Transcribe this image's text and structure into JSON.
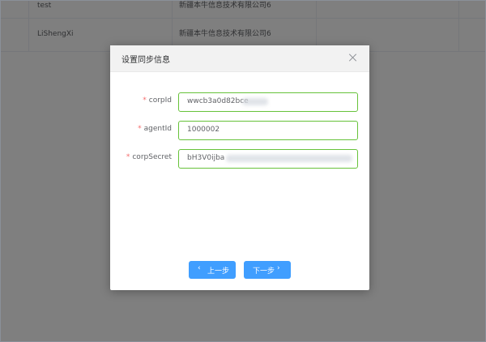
{
  "background_table": {
    "rows": [
      {
        "name": "test",
        "company": "新疆本牛信息技术有限公司6"
      },
      {
        "name": "LiShengXi",
        "company": "新疆本牛信息技术有限公司6"
      }
    ]
  },
  "dialog": {
    "title": "设置同步信息",
    "fields": [
      {
        "label": "corpId",
        "value": "wwcb3a0d82bce",
        "required_mark": "*"
      },
      {
        "label": "agentId",
        "value": "1000002",
        "required_mark": "*"
      },
      {
        "label": "corpSecret",
        "value": "bH3V0ijba",
        "required_mark": "*"
      }
    ],
    "prev_button": "上一步",
    "next_button": "下一步",
    "prev_chevron": "‹",
    "next_chevron": "›"
  },
  "colors": {
    "primary": "#409eff",
    "success_border": "#67c23a",
    "required": "#f56c6c"
  }
}
